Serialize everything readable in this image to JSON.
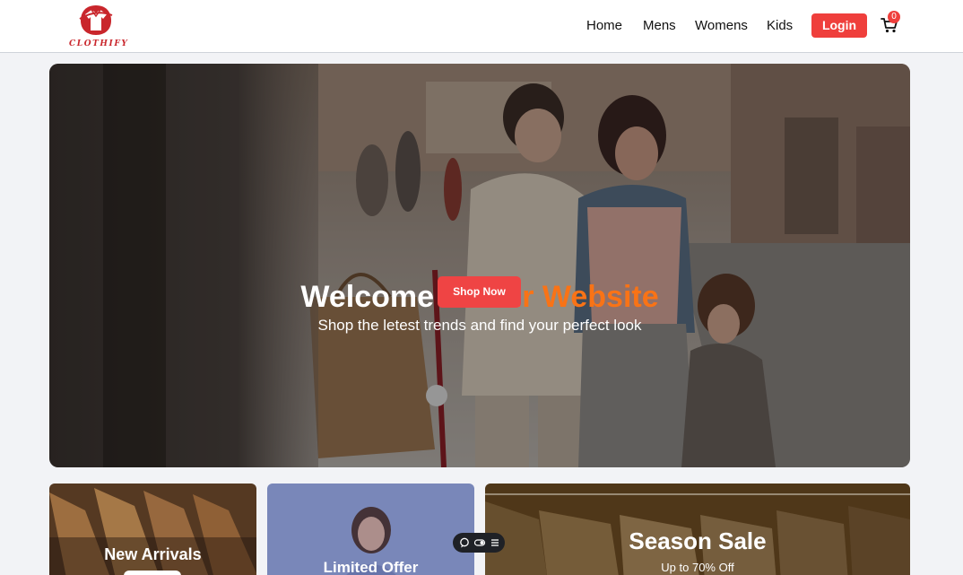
{
  "brand": {
    "name": "CLOTHIFY"
  },
  "nav": {
    "items": [
      {
        "label": "Home"
      },
      {
        "label": "Mens"
      },
      {
        "label": "Womens"
      },
      {
        "label": "Kids"
      }
    ],
    "login_label": "Login",
    "cart_count": "0"
  },
  "hero": {
    "title_part1": "Welcome to ",
    "title_part2": "Our Website",
    "subtitle": "Shop the letest trends and find your perfect look",
    "cta_label": "Shop Now"
  },
  "cards": [
    {
      "title": "New Arrivals"
    },
    {
      "title": "Limited Offer"
    },
    {
      "title": "Season Sale",
      "subtitle": "Up to 70% Off"
    }
  ],
  "colors": {
    "accent_red": "#ef4444",
    "accent_orange": "#f97316",
    "background": "#f2f3f6"
  },
  "icons": {
    "cart": "cart-icon",
    "chat": "chat-icon",
    "toggle": "toggle-icon",
    "menu": "menu-icon"
  }
}
